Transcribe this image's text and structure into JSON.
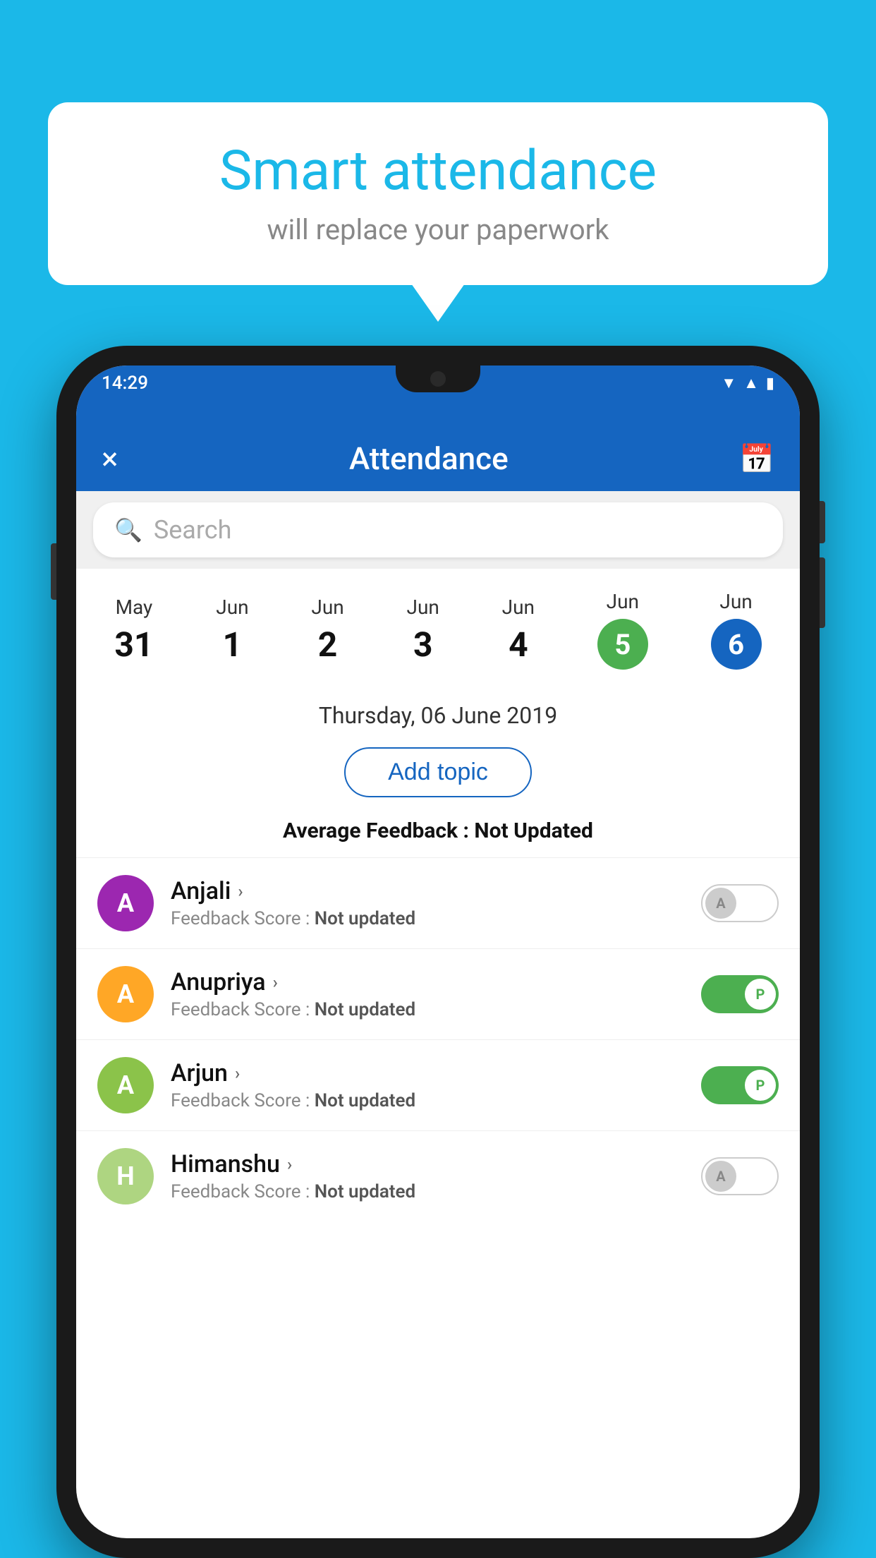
{
  "background_color": "#1bb8e8",
  "bubble": {
    "title": "Smart attendance",
    "subtitle": "will replace your paperwork"
  },
  "app": {
    "screen_title": "Attendance",
    "close_label": "×",
    "status_time": "14:29",
    "search_placeholder": "Search",
    "selected_date_label": "Thursday, 06 June 2019",
    "add_topic_label": "Add topic",
    "avg_feedback_label": "Average Feedback : ",
    "avg_feedback_value": "Not Updated",
    "calendar": {
      "days": [
        {
          "month": "May",
          "date": "31",
          "state": "normal"
        },
        {
          "month": "Jun",
          "date": "1",
          "state": "normal"
        },
        {
          "month": "Jun",
          "date": "2",
          "state": "normal"
        },
        {
          "month": "Jun",
          "date": "3",
          "state": "normal"
        },
        {
          "month": "Jun",
          "date": "4",
          "state": "normal"
        },
        {
          "month": "Jun",
          "date": "5",
          "state": "today"
        },
        {
          "month": "Jun",
          "date": "6",
          "state": "selected"
        }
      ]
    },
    "students": [
      {
        "name": "Anjali",
        "avatar_letter": "A",
        "avatar_color": "#9c27b0",
        "feedback": "Feedback Score : ",
        "feedback_value": "Not updated",
        "toggle": "off",
        "toggle_label": "A"
      },
      {
        "name": "Anupriya",
        "avatar_letter": "A",
        "avatar_color": "#ffa726",
        "feedback": "Feedback Score : ",
        "feedback_value": "Not updated",
        "toggle": "on",
        "toggle_label": "P"
      },
      {
        "name": "Arjun",
        "avatar_letter": "A",
        "avatar_color": "#8bc34a",
        "feedback": "Feedback Score : ",
        "feedback_value": "Not updated",
        "toggle": "on",
        "toggle_label": "P"
      },
      {
        "name": "Himanshu",
        "avatar_letter": "H",
        "avatar_color": "#aed581",
        "feedback": "Feedback Score : ",
        "feedback_value": "Not updated",
        "toggle": "off",
        "toggle_label": "A"
      }
    ]
  }
}
